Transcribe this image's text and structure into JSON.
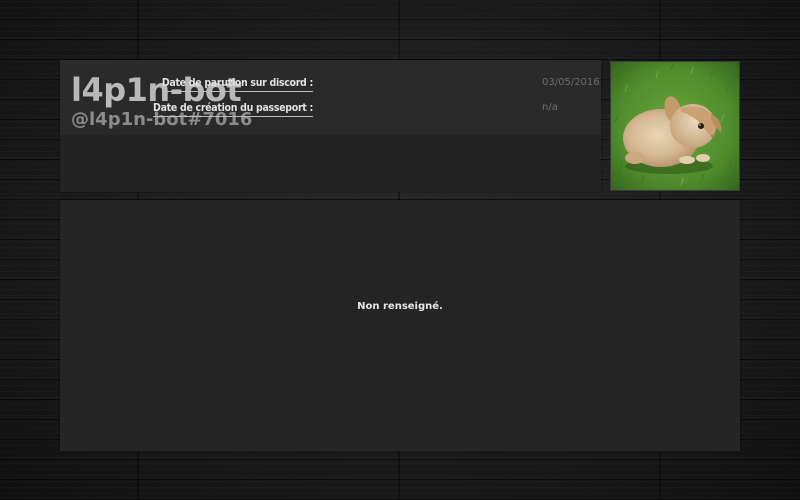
{
  "profile": {
    "name": "l4p1n-bot",
    "tag": "@l4p1n-bot#7016",
    "avatar_icon": "rabbit-photo"
  },
  "info": {
    "discord_date_label": "Date de parution sur discord :",
    "discord_date_value": "03/05/2016",
    "passport_date_label": "Date de création du passeport :",
    "passport_date_value": "n/a"
  },
  "bio": {
    "text": "Non renseigné."
  },
  "colors": {
    "page_background": "#161616",
    "panel_background": "#232323",
    "header_band": "#2a2a2a",
    "name_text": "#b9b9b9",
    "tag_text": "#8c8c8c",
    "label_text": "#e2e2e2",
    "value_text": "#6d6d6d"
  }
}
